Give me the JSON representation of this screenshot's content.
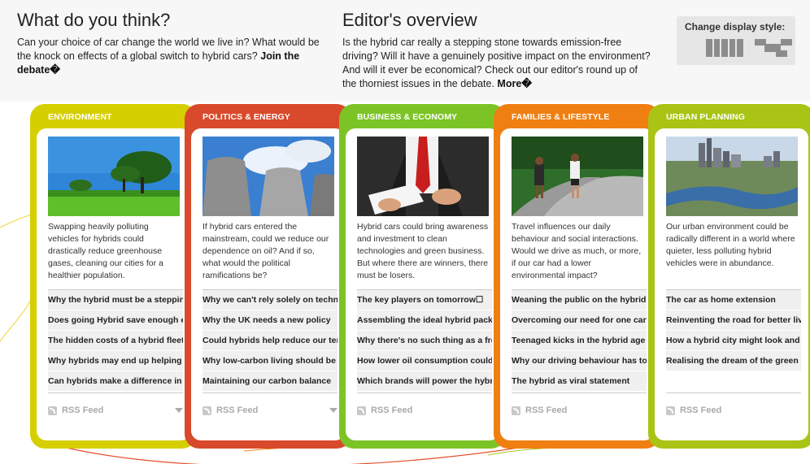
{
  "intro_left": {
    "title": "What do you think?",
    "text": "Can your choice of car change the world we live in? What would be the knock on effects of a global switch to hybrid cars?",
    "link": "Join the debate�"
  },
  "intro_right": {
    "title": "Editor's overview",
    "text": "Is the hybrid car really a stepping stone towards emission-free driving? Will it have a genuinely positive impact on the environment? And will it ever be economical? Check out our editor's round up of the thorniest issues in the debate.",
    "link": "More�"
  },
  "display_style": {
    "label": "Change display style:"
  },
  "rss_label": "RSS Feed",
  "cards": [
    {
      "title": "ENVIRONMENT",
      "color": "#d6cf00",
      "photo": "trees-on-field",
      "description": "Swapping heavily polluting vehicles for hybrids could drastically reduce greenhouse gases, cleaning our cities for a healthier population.",
      "links": [
        "Why the hybrid must be a stepping stone",
        "Does going Hybrid save enough emissions",
        "The hidden costs of a hybrid fleet",
        "Why hybrids may end up helping oil",
        "Can hybrids make a difference in time"
      ]
    },
    {
      "title": "POLITICS & ENERGY",
      "color": "#d84a2b",
      "photo": "cooling-towers",
      "description": "If hybrid cars entered the mainstream, could we reduce our dependence on oil? And if so, what would the political ramifications be?",
      "links": [
        "Why we can't rely solely on technology",
        "Why the UK needs a new policy",
        "Could hybrids help reduce our tensions",
        "Why low-carbon living should be policy",
        "Maintaining our carbon balance"
      ]
    },
    {
      "title": "BUSINESS & ECONOMY",
      "color": "#7cc425",
      "photo": "business-meeting",
      "description": "Hybrid cars could bring awareness and investment to clean technologies and green business. But where there are winners, there must be losers.",
      "links": [
        "The key players on tomorrow☐",
        "Assembling the ideal hybrid package",
        "Why there's no such thing as a free ride",
        "How lower oil consumption could help",
        "Which brands will power the hybrid age"
      ]
    },
    {
      "title": "FAMILIES & LIFESTYLE",
      "color": "#f07f12",
      "photo": "joggers-in-park",
      "description": "Travel influences our daily behaviour and social interactions. Would we drive as much, or more, if our car had a lower environmental impact?",
      "links": [
        "Weaning the public on the hybrid",
        "Overcoming our need for one car",
        "Teenaged kicks in the hybrid age",
        "Why our driving behaviour has to change",
        "The hybrid as viral statement"
      ]
    },
    {
      "title": "URBAN PLANNING",
      "color": "#a9c414",
      "photo": "city-river-skyline",
      "description": "Our urban environment could be radically different in a world where quieter, less polluting hybrid vehicles were in abundance.",
      "links": [
        "The car as home extension",
        "Reinventing the road for better living",
        "How a hybrid city might look and feel",
        "Realising the dream of the green city"
      ]
    }
  ]
}
